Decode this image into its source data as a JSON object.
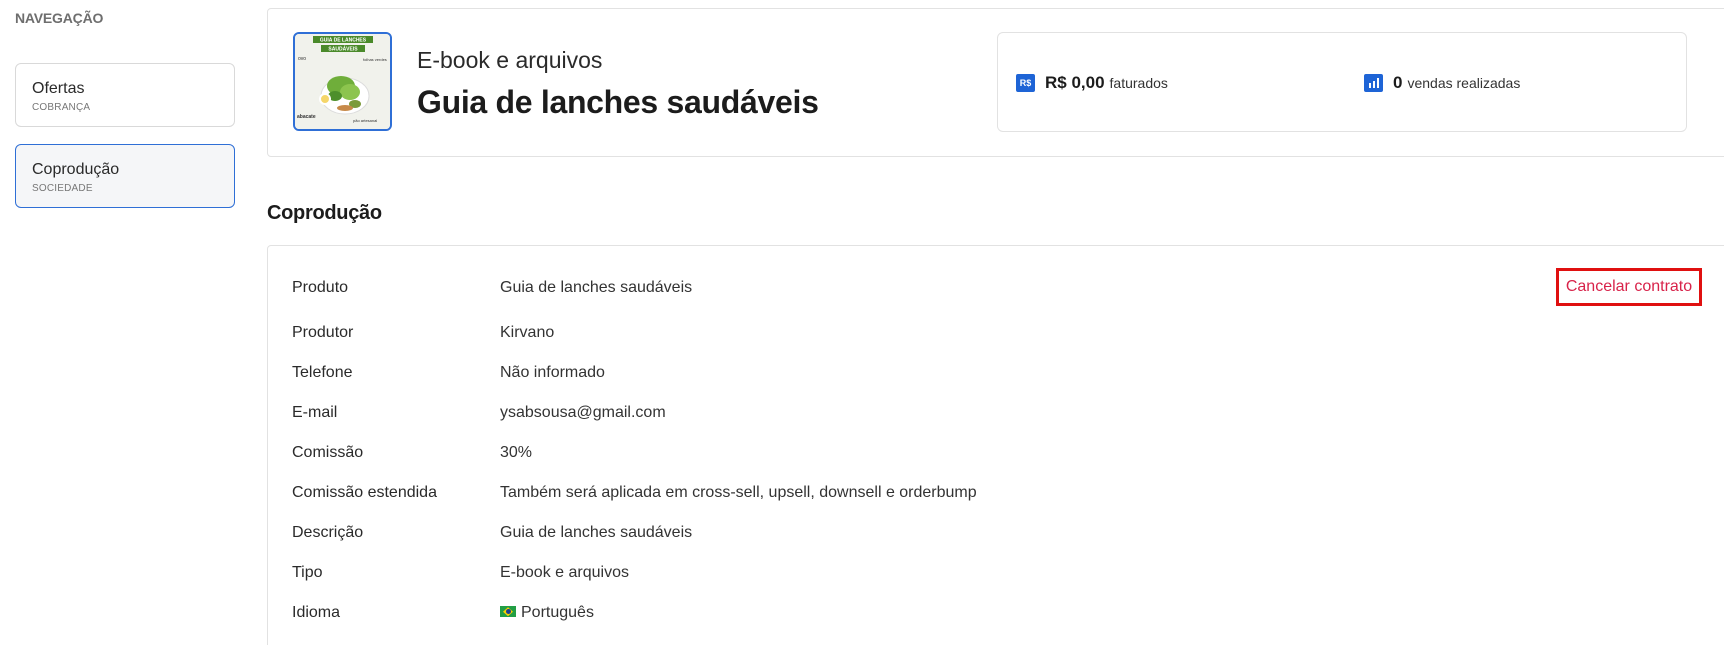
{
  "sidebar": {
    "title": "NAVEGAÇÃO",
    "items": [
      {
        "label": "Ofertas",
        "sub": "COBRANÇA"
      },
      {
        "label": "Coprodução",
        "sub": "SOCIEDADE"
      }
    ]
  },
  "product": {
    "category": "E-book e arquivos",
    "title": "Guia de lanches saudáveis",
    "thumbnail": {
      "banner_line1": "GUIA DE LANCHES",
      "banner_line2": "SAUDÁVEIS",
      "labels": [
        "ovo",
        "folhas verdes",
        "abacate",
        "pão artesanal"
      ]
    }
  },
  "stats": {
    "revenue_icon": "R$",
    "revenue_value": "R$ 0,00",
    "revenue_label": "faturados",
    "sales_icon": "bar-chart-icon",
    "sales_value": "0",
    "sales_label": "vendas realizadas"
  },
  "section": {
    "title": "Coprodução",
    "cancel_label": "Cancelar contrato",
    "rows": [
      {
        "key": "Produto",
        "value": "Guia de lanches saudáveis"
      },
      {
        "key": "Produtor",
        "value": "Kirvano"
      },
      {
        "key": "Telefone",
        "value": "Não informado"
      },
      {
        "key": "E-mail",
        "value": "ysabsousa@gmail.com"
      },
      {
        "key": "Comissão",
        "value": "30%"
      },
      {
        "key": "Comissão estendida",
        "value": "Também será aplicada em cross-sell, upsell, downsell e orderbump"
      },
      {
        "key": "Descrição",
        "value": "Guia de lanches saudáveis"
      },
      {
        "key": "Tipo",
        "value": "E-book e arquivos"
      },
      {
        "key": "Idioma",
        "value": "Português"
      }
    ]
  },
  "colors": {
    "accent_blue": "#1e64d6",
    "cancel_red": "#d8234a",
    "highlight_red": "#e01010"
  }
}
